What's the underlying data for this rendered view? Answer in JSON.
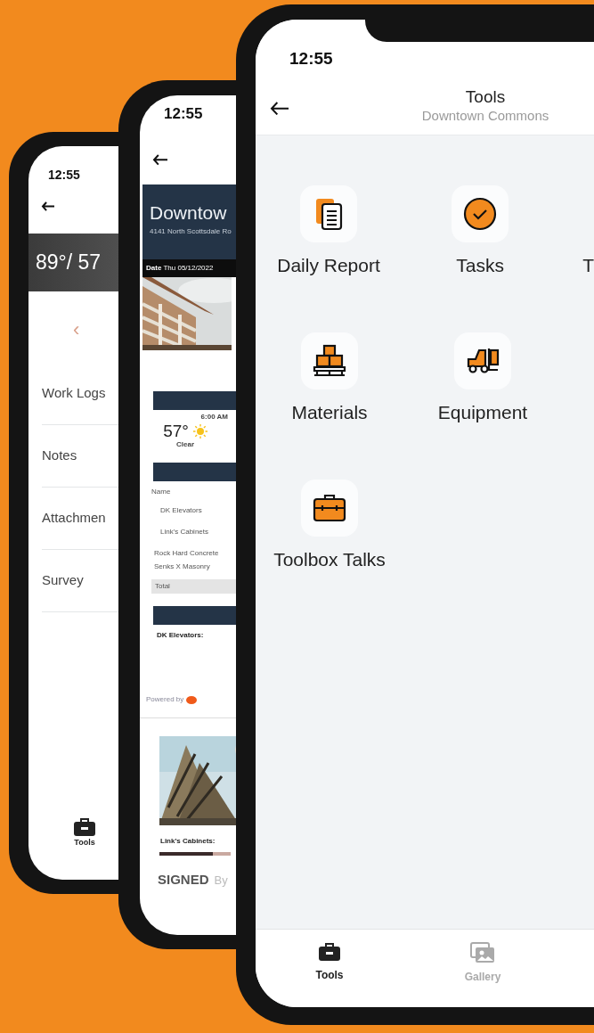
{
  "back_phone": {
    "time": "12:55",
    "weather": "89°/ 57",
    "pager_arrow": "‹",
    "menu_items": [
      "Work Logs",
      "Notes",
      "Attachmen",
      "Survey"
    ],
    "tab_bar": [
      {
        "label": "Tools",
        "kind": "toolbox",
        "selected": true
      }
    ]
  },
  "middle_phone": {
    "time": "12:55",
    "report": {
      "title": "Downtow",
      "address": "4141 North Scottsdale Ro",
      "date": "**Date** Thu 05/12/2022",
      "weather": {
        "time": "6:00 AM",
        "temperature": "57°",
        "condition": "Clear"
      },
      "table_header": "Name",
      "rows": [
        "DK Elevators",
        "Link's Cabinets",
        "Rock Hard Concrete",
        "Senks X Masonry"
      ],
      "total_label": "Total",
      "section_title": "DK Elevators:",
      "powered_by": "Powered by"
    },
    "second_section_title": "Link's Cabinets:",
    "signed": "SIGNED",
    "signed_by": "By"
  },
  "front_phone": {
    "time": "12:55",
    "title": "Tools",
    "subtitle": "Downtown Commons",
    "tool_rows": [
      [
        {
          "label": "Daily Report",
          "kind": "report"
        },
        {
          "label": "Tasks",
          "kind": "tasks"
        },
        {
          "label": "T",
          "kind": "partial"
        }
      ],
      [
        {
          "label": "Materials",
          "kind": "materials"
        },
        {
          "label": "Equipment",
          "kind": "equipment"
        }
      ],
      [
        {
          "label": "Toolbox Talks",
          "kind": "toolbox"
        }
      ]
    ],
    "tab_bar": [
      {
        "label": "Tools",
        "kind": "toolbox",
        "selected": true
      },
      {
        "label": "Gallery",
        "kind": "gallery",
        "selected": false
      }
    ]
  }
}
